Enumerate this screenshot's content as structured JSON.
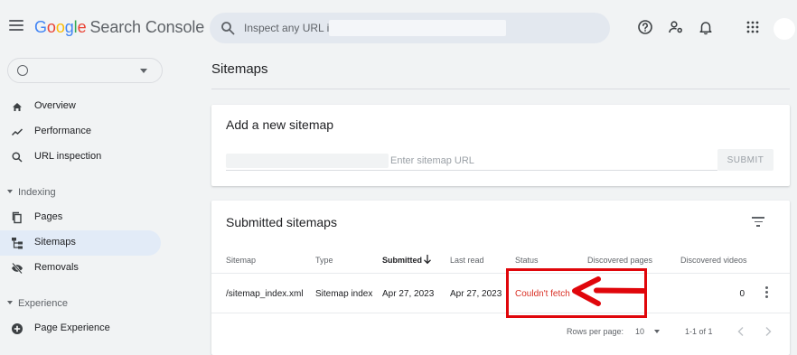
{
  "app": {
    "logo_letters": [
      "G",
      "o",
      "o",
      "g",
      "l",
      "e"
    ],
    "logo_rest": "Search Console"
  },
  "search": {
    "placeholder": "Inspect any URL in"
  },
  "header_icons": [
    "help-icon",
    "manage-users-icon",
    "notifications-icon",
    "apps-grid-icon"
  ],
  "sidebar": {
    "items_top": [
      {
        "label": "Overview",
        "icon": "home-icon"
      },
      {
        "label": "Performance",
        "icon": "trending-icon"
      },
      {
        "label": "URL inspection",
        "icon": "search-icon"
      }
    ],
    "sections": [
      {
        "label": "Indexing"
      },
      {
        "label": "Experience"
      }
    ],
    "items_indexing": [
      {
        "label": "Pages",
        "icon": "pages-icon"
      },
      {
        "label": "Sitemaps",
        "icon": "sitemap-icon",
        "active": true
      },
      {
        "label": "Removals",
        "icon": "removals-icon"
      }
    ],
    "items_experience": [
      {
        "label": "Page Experience",
        "icon": "page-experience-icon"
      }
    ]
  },
  "main": {
    "title": "Sitemaps",
    "add_card": {
      "title": "Add a new sitemap",
      "input_placeholder": "Enter sitemap URL",
      "submit_label": "SUBMIT"
    },
    "submitted_card": {
      "title": "Submitted sitemaps",
      "columns": [
        "Sitemap",
        "Type",
        "Submitted",
        "Last read",
        "Status",
        "Discovered pages",
        "Discovered videos"
      ],
      "sorted_column": "Submitted",
      "rows": [
        {
          "sitemap": "/sitemap_index.xml",
          "type": "Sitemap index",
          "submitted": "Apr 27, 2023",
          "last_read": "Apr 27, 2023",
          "status": "Couldn't fetch",
          "discovered_pages": "",
          "discovered_videos": "0"
        }
      ],
      "pagination": {
        "rows_per_page_label": "Rows per page:",
        "rows_per_page": "10",
        "range": "1-1 of 1"
      }
    }
  },
  "colors": {
    "status_error": "#d93025",
    "annotation": "#e0060b",
    "active_nav": "#e2ebf7"
  }
}
